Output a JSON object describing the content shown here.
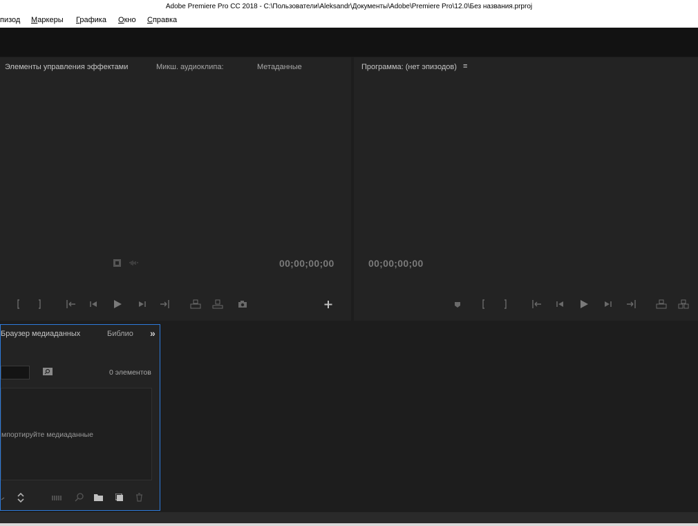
{
  "window": {
    "title": "Adobe Premiere Pro CC 2018 - C:\\Пользователи\\Aleksandr\\Документы\\Adobe\\Premiere Pro\\12.0\\Без названия.prproj"
  },
  "menu": {
    "items": [
      {
        "pre": "",
        "u": "",
        "post": "пизод"
      },
      {
        "pre": "",
        "u": "М",
        "post": "аркеры"
      },
      {
        "pre": "",
        "u": "Г",
        "post": "рафика"
      },
      {
        "pre": "",
        "u": "О",
        "post": "кно"
      },
      {
        "pre": "",
        "u": "С",
        "post": "правка"
      }
    ]
  },
  "source": {
    "tabs": [
      "Элементы управления эффектами",
      "Микш. аудиоклипа:",
      "Метаданные"
    ],
    "timecode": "00;00;00;00"
  },
  "program": {
    "tab": "Программа: (нет эпизодов)",
    "menu_glyph": "≡",
    "timecode": "00;00;00;00"
  },
  "project": {
    "tabs": [
      "Браузер медиаданных",
      "Библио"
    ],
    "overflow": "»",
    "count": "0 элементов",
    "empty_hint": "мпортируйте медиаданные"
  },
  "colors": {
    "accent": "#2d7bdc",
    "panel_bg": "#232323",
    "app_bg": "#1d1d1d"
  }
}
